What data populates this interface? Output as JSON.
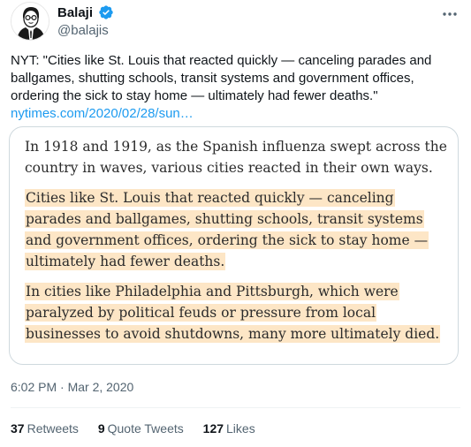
{
  "author": {
    "display_name": "Balaji",
    "handle": "@balajis",
    "verified": true
  },
  "tweet": {
    "text": "NYT: \"Cities like St. Louis that reacted quickly — canceling parades and ballgames, shutting schools, transit systems and government offices, ordering the sick to stay home — ultimately had fewer deaths.\"",
    "link": "nytimes.com/2020/02/28/sun…"
  },
  "quote_card": {
    "para1": "In 1918 and 1919, as the Spanish influenza swept across the country in waves, various cities reacted in their own ways.",
    "para2": "Cities like St. Louis that reacted quickly — canceling parades and ballgames, shutting schools, transit systems and government offices, ordering the sick to stay home — ultimately had fewer deaths.",
    "para3": "In cities like Philadelphia and Pittsburgh, which were paralyzed by political feuds or pressure from local businesses to avoid shutdowns, many more ultimately died.",
    "highlight_color": "#fde6c6"
  },
  "meta": {
    "timestamp": "6:02 PM · Mar 2, 2020"
  },
  "stats": {
    "retweets_count": "37",
    "retweets_label": "Retweets",
    "quotes_count": "9",
    "quotes_label": "Quote Tweets",
    "likes_count": "127",
    "likes_label": "Likes"
  },
  "colors": {
    "accent": "#1d9bf0",
    "secondary_text": "#536471",
    "primary_text": "#0f1419",
    "border": "#cfd9de"
  },
  "icons": {
    "verified": "verified-badge-icon",
    "more": "more-horizontal-icon"
  }
}
